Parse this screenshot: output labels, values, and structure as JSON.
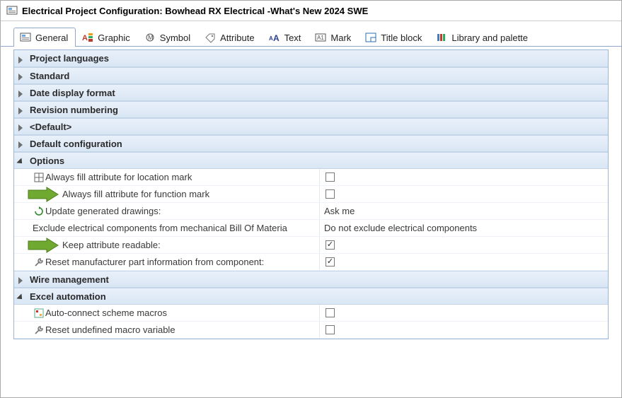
{
  "window": {
    "title": "Electrical Project Configuration: Bowhead RX Electrical -What's New 2024 SWE"
  },
  "tabs": [
    {
      "label": "General",
      "active": true
    },
    {
      "label": "Graphic",
      "active": false
    },
    {
      "label": "Symbol",
      "active": false
    },
    {
      "label": "Attribute",
      "active": false
    },
    {
      "label": "Text",
      "active": false
    },
    {
      "label": "Mark",
      "active": false
    },
    {
      "label": "Title block",
      "active": false
    },
    {
      "label": "Library and palette",
      "active": false
    }
  ],
  "sections": {
    "project_languages": {
      "label": "Project languages",
      "expanded": false
    },
    "standard": {
      "label": "Standard",
      "expanded": false
    },
    "date_display": {
      "label": "Date display format",
      "expanded": false
    },
    "revision": {
      "label": "Revision numbering",
      "expanded": false
    },
    "default": {
      "label": "<Default>",
      "expanded": false
    },
    "default_config": {
      "label": "Default configuration",
      "expanded": false
    },
    "options": {
      "label": "Options",
      "expanded": true
    },
    "wire_mgmt": {
      "label": "Wire management",
      "expanded": false
    },
    "excel": {
      "label": "Excel automation",
      "expanded": true
    }
  },
  "options_rows": {
    "fill_location": {
      "label": "Always fill attribute for location mark",
      "checked": false
    },
    "fill_function": {
      "label": "Always fill attribute for function mark",
      "checked": false
    },
    "update_drawings": {
      "label": "Update generated drawings:",
      "value": "Ask me"
    },
    "exclude_bom": {
      "label": "Exclude electrical components from mechanical Bill Of Materia",
      "value": "Do not exclude electrical components"
    },
    "keep_readable": {
      "label": "Keep attribute readable:",
      "checked": true
    },
    "reset_mfr": {
      "label": "Reset manufacturer part information from component:",
      "checked": true
    }
  },
  "excel_rows": {
    "auto_connect": {
      "label": "Auto-connect scheme macros",
      "checked": false
    },
    "reset_macro": {
      "label": "Reset undefined macro variable",
      "checked": false
    }
  }
}
